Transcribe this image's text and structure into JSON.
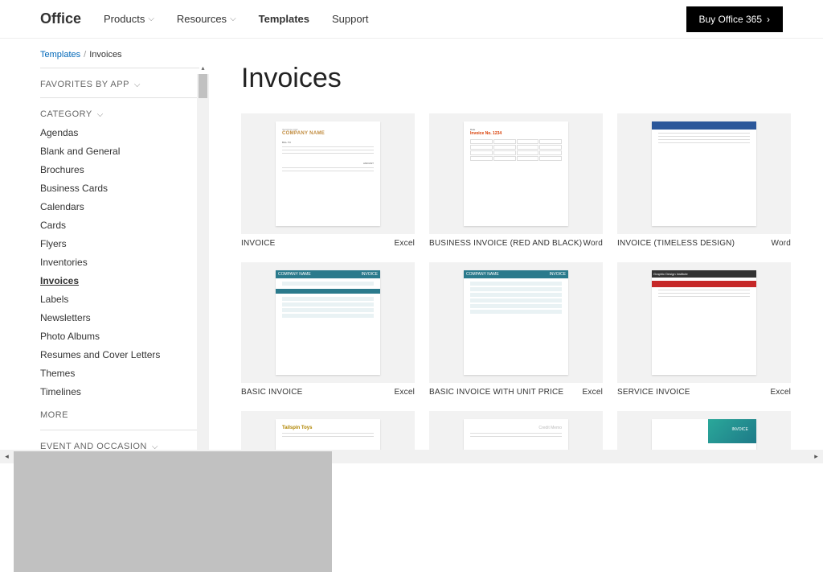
{
  "header": {
    "brand": "Office",
    "nav": [
      {
        "label": "Products",
        "dropdown": true
      },
      {
        "label": "Resources",
        "dropdown": true
      },
      {
        "label": "Templates",
        "dropdown": false,
        "active": true
      },
      {
        "label": "Support",
        "dropdown": false
      }
    ],
    "cta": "Buy Office 365"
  },
  "breadcrumb": {
    "root": "Templates",
    "current": "Invoices",
    "sep": "/"
  },
  "sidebar": {
    "favorites_header": "FAVORITES BY APP",
    "category_header": "CATEGORY",
    "categories": [
      "Agendas",
      "Blank and General",
      "Brochures",
      "Business Cards",
      "Calendars",
      "Cards",
      "Flyers",
      "Inventories",
      "Invoices",
      "Labels",
      "Newsletters",
      "Photo Albums",
      "Resumes and Cover Letters",
      "Themes",
      "Timelines"
    ],
    "selected_category": "Invoices",
    "more": "MORE",
    "event_header": "EVENT AND OCCASION"
  },
  "main": {
    "title": "Invoices",
    "templates": [
      {
        "name": "INVOICE",
        "app": "Excel"
      },
      {
        "name": "BUSINESS INVOICE (RED AND BLACK)",
        "app": "Word"
      },
      {
        "name": "INVOICE (TIMELESS DESIGN)",
        "app": "Word"
      },
      {
        "name": "BASIC INVOICE",
        "app": "Excel"
      },
      {
        "name": "BASIC INVOICE WITH UNIT PRICE",
        "app": "Excel"
      },
      {
        "name": "SERVICE INVOICE",
        "app": "Excel"
      }
    ]
  }
}
